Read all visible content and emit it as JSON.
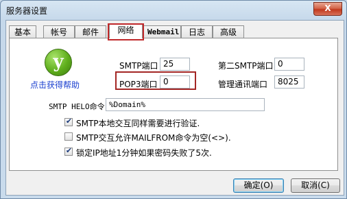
{
  "window": {
    "title": "服务器设置",
    "close_label": "X"
  },
  "tabs": [
    {
      "label": "基本"
    },
    {
      "label": "帐号"
    },
    {
      "label": "邮件"
    },
    {
      "label": "网络"
    },
    {
      "label": "Webmail"
    },
    {
      "label": "日志"
    },
    {
      "label": "高级"
    }
  ],
  "active_tab": "网络",
  "help": {
    "icon_glyph": "y",
    "link_text": "点击获得帮助"
  },
  "fields": {
    "smtp_port": {
      "label": "SMTP端口",
      "value": "25"
    },
    "second_smtp_port": {
      "label": "第二SMTP端口",
      "value": "0"
    },
    "pop3_port": {
      "label": "POP3端口",
      "value": "0"
    },
    "admin_port": {
      "label": "管理通讯端口",
      "value": "8025"
    },
    "smtp_helo": {
      "label": "SMTP HELO命令",
      "value": "%Domain%"
    }
  },
  "checkboxes": [
    {
      "label": "SMTP本地交互同样需要进行验证.",
      "checked": true
    },
    {
      "label": "SMTP交互允许MAILFROM命令为空(<>).",
      "checked": false
    },
    {
      "label": "锁定IP地址1分钟如果密码失败了5次.",
      "checked": true
    }
  ],
  "buttons": {
    "ok": "确定(O)",
    "cancel": "取消(C)"
  }
}
